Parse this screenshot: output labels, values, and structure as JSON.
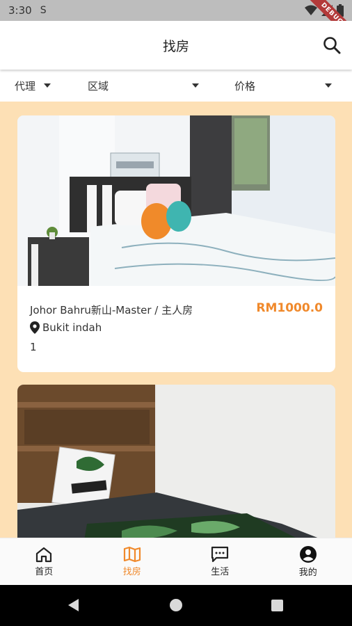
{
  "status_bar": {
    "time": "3:30",
    "sim_indicator": "S",
    "debug_label": "DEBUG",
    "icons": [
      "wifi-icon",
      "signal-icon",
      "battery-icon"
    ]
  },
  "app_bar": {
    "title": "找房",
    "search_icon": "search-icon"
  },
  "filters": [
    {
      "label": "代理"
    },
    {
      "label": "区域"
    },
    {
      "label": "价格"
    }
  ],
  "listings": [
    {
      "title": "Johor Bahru新山-Master / 主人房",
      "price": "RM1000.0",
      "location": "Bukit indah",
      "count": "1",
      "photo": "bedroom photo with FAMILY sign and dinosaur plush toys"
    },
    {
      "photo": "bedroom photo with pillow and green leaf bedding"
    }
  ],
  "bottom_nav": [
    {
      "label": "首页",
      "icon": "home-icon"
    },
    {
      "label": "找房",
      "icon": "map-icon",
      "active": true
    },
    {
      "label": "生活",
      "icon": "chat-icon"
    },
    {
      "label": "我的",
      "icon": "account-icon"
    }
  ],
  "colors": {
    "accent": "#f0892b",
    "list_background": "#fde0b5",
    "status_bar": "#bdbdbd"
  }
}
